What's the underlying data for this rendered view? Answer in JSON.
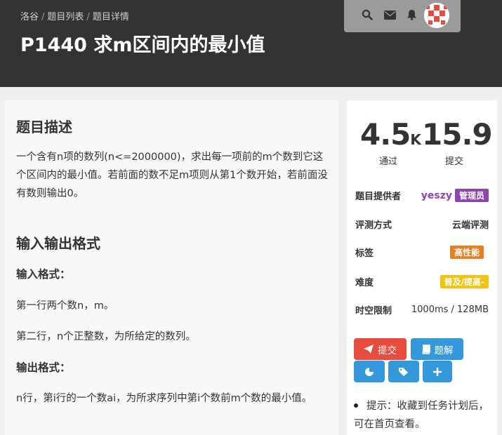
{
  "breadcrumb": {
    "items": [
      "洛谷",
      "题目列表",
      "题目详情"
    ],
    "separator": "/"
  },
  "page_title": "P1440 求m区间内的最小值",
  "nav_icons": [
    "search-icon",
    "envelope-icon",
    "bell-icon",
    "avatar"
  ],
  "description": {
    "title": "题目描述",
    "text": "一个含有n项的数列(n<=2000000)，求出每一项前的m个数到它这个区间内的最小值。若前面的数不足m项则从第1个数开始，若前面没有数则输出0。"
  },
  "io": {
    "title": "输入输出格式",
    "input_title": "输入格式：",
    "input_line1": "第一行两个数n，m。",
    "input_line2": "第二行，n个正整数，为所给定的数列。",
    "output_title": "输出格式：",
    "output_text": "n行，第i行的一个数ai，为所求序列中第i个数前m个数的最小值。"
  },
  "stats": {
    "passed_value": "4.5",
    "passed_unit": "K",
    "passed_label": "通过",
    "submitted_value": "15.9",
    "submitted_label": "提交"
  },
  "info": {
    "provider_label": "题目提供者",
    "provider_name": "yeszy",
    "provider_badge": "管理员",
    "judge_label": "评测方式",
    "judge_value": "云端评测",
    "tags_label": "标签",
    "tag": "高性能",
    "difficulty_label": "难度",
    "difficulty": "普及/提高-",
    "limit_label": "时空限制",
    "limit_value": "1000ms / 128MB"
  },
  "actions": {
    "submit_label": "提交",
    "solution_label": "题解"
  },
  "tip": "提示：收藏到任务计划后，可在首页查看。",
  "colors": {
    "header_bg": "#333333",
    "admin_badge": "#8e44ad",
    "tag_badge": "#e67e22",
    "difficulty_badge": "#f1c40f",
    "submit_btn": "#e74c3c",
    "action_btn": "#3498db"
  }
}
